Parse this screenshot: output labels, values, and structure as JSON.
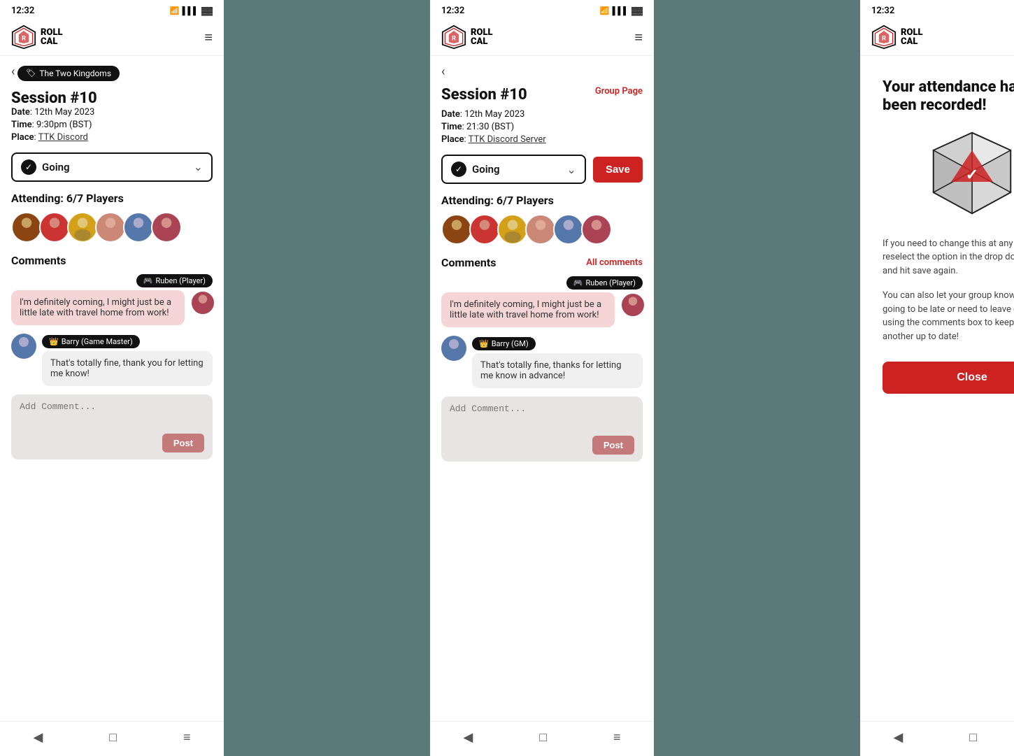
{
  "panels": [
    {
      "id": "left",
      "status": {
        "time": "12:32",
        "icons": "WiFi Signal Battery"
      },
      "header": {
        "logo_line1": "ROLL",
        "logo_line2": "CAL",
        "menu_icon": "≡"
      },
      "tag": "The Two Kingdoms",
      "session_title": "Session #10",
      "details": {
        "date_label": "Date",
        "date_value": "12th May 2023",
        "time_label": "Time",
        "time_value": "9:30pm (BST)",
        "place_label": "Place",
        "place_value": "TTK Discord"
      },
      "going_label": "Going",
      "attending": {
        "label": "Attending:",
        "count": "6/7 Players"
      },
      "comments_title": "Comments",
      "comments": [
        {
          "author": "Ruben (Player)",
          "role_icon": "🎮",
          "text": "I'm definitely coming, I might just be a little late with travel home from work!",
          "type": "right"
        },
        {
          "author": "Barry (Game Master)",
          "role_icon": "👑",
          "text": "That's totally fine, thank you for letting me know!",
          "type": "left"
        }
      ],
      "add_comment_placeholder": "Add Comment...",
      "post_label": "Post"
    },
    {
      "id": "middle",
      "status": {
        "time": "12:32"
      },
      "header": {
        "logo_line1": "ROLL",
        "logo_line2": "CAL",
        "menu_icon": "≡"
      },
      "session_title": "Session #10",
      "group_page_label": "Group Page",
      "details": {
        "date_label": "Date",
        "date_value": "12th May 2023",
        "time_label": "Time",
        "time_value": "21:30 (BST)",
        "place_label": "Place",
        "place_value": "TTK Discord Server"
      },
      "going_label": "Going",
      "save_label": "Save",
      "attending": {
        "label": "Attending:",
        "count": "6/7 Players"
      },
      "comments_title": "Comments",
      "all_comments_label": "All comments",
      "comments": [
        {
          "author": "Ruben (Player)",
          "role_icon": "🎮",
          "text": "I'm definitely coming, I might just be a little late with travel home from work!",
          "type": "right"
        },
        {
          "author": "Barry (GM)",
          "role_icon": "👑",
          "text": "That's totally fine, thanks for letting me know in advance!",
          "type": "left"
        }
      ],
      "add_comment_placeholder": "Add Comment...",
      "post_label": "Post"
    },
    {
      "id": "right",
      "status": {
        "time": "12:32"
      },
      "header": {
        "logo_line1": "ROLL",
        "logo_line2": "CAL",
        "close_icon": "✕"
      },
      "confirmation_title": "Your attendance has been recorded!",
      "confirmation_text1": "If you need to change this at any point, just reselect the option in the drop down menu and hit save again.",
      "confirmation_text2": "You can also let your group know if you're going to be late or need to leave early by using the comments box to keep one another up to date!",
      "close_label": "Close"
    }
  ]
}
